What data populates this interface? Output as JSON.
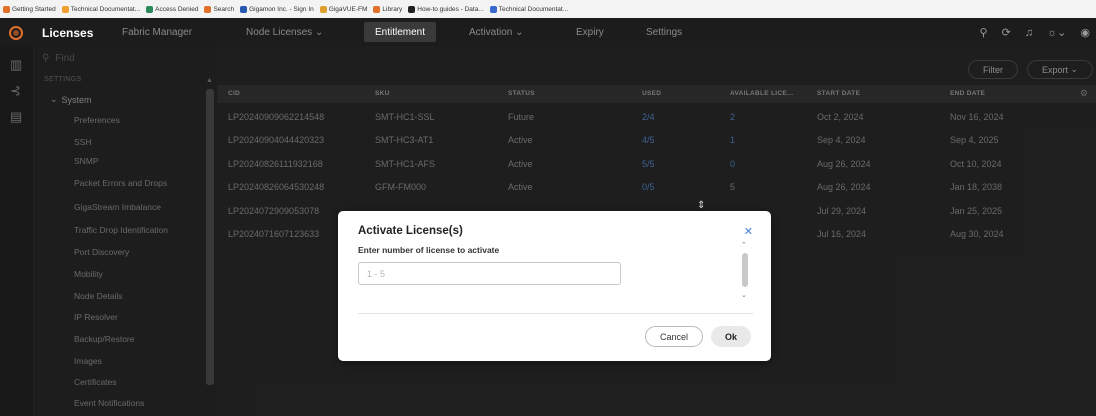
{
  "bookmarks": [
    {
      "label": "Getting Started",
      "color": "#e0702a"
    },
    {
      "label": "Technical Documentat...",
      "color": "#f0a030"
    },
    {
      "label": "Access Denied",
      "color": "#2a8a5a"
    },
    {
      "label": "Search",
      "color": "#e0702a"
    },
    {
      "label": "Gigamon Inc. - Sign In",
      "color": "#2a5ab0"
    },
    {
      "label": "GigaVUE-FM",
      "color": "#e0a030"
    },
    {
      "label": "Library",
      "color": "#e0702a"
    },
    {
      "label": "How-to guides - Data...",
      "color": "#222222"
    },
    {
      "label": "Technical Documentat...",
      "color": "#3a6ad0"
    }
  ],
  "topnav": {
    "product": "Licenses",
    "app": "Fabric Manager",
    "tabs": [
      "Node Licenses",
      "Entitlement",
      "Activation",
      "Expiry",
      "Settings"
    ],
    "active_tab": "Entitlement"
  },
  "sidebar": {
    "search_placeholder": "Find",
    "section": "SETTINGS",
    "group": "System",
    "items": [
      "Preferences",
      "SSH",
      "SNMP",
      "Packet Errors and Drops",
      "GigaStream Imbalance",
      "Traffic Drop Identification",
      "Port Discovery",
      "Mobility",
      "Node Details",
      "IP Resolver",
      "Backup/Restore",
      "Images",
      "Certificates",
      "Event Notifications"
    ]
  },
  "toolbar": {
    "filter": "Filter",
    "export": "Export"
  },
  "table": {
    "headers": [
      "CID",
      "SKU",
      "STATUS",
      "USED",
      "AVAILABLE LICE...",
      "START DATE",
      "END DATE"
    ],
    "rows": [
      [
        "LP20240909062214548",
        "SMT-HC1-SSL",
        "Future",
        "2/4",
        "2",
        "Oct 2, 2024",
        "Nov 16, 2024"
      ],
      [
        "LP20240904044420323",
        "SMT-HC3-AT1",
        "Active",
        "4/5",
        "1",
        "Sep 4, 2024",
        "Sep 4, 2025"
      ],
      [
        "LP20240826111932168",
        "SMT-HC1-AFS",
        "Active",
        "5/5",
        "0",
        "Aug 26, 2024",
        "Oct 10, 2024"
      ],
      [
        "LP20240826064530248",
        "GFM-FM000",
        "Active",
        "0/5",
        "5",
        "Aug 26, 2024",
        "Jan 18, 2038"
      ],
      [
        "LP2024072909053078",
        "",
        "",
        "",
        "",
        "Jul 29, 2024",
        "Jan 25, 2025"
      ],
      [
        "LP2024071607123633",
        "",
        "",
        "",
        "",
        "Jul 16, 2024",
        "Aug 30, 2024"
      ]
    ]
  },
  "modal": {
    "title": "Activate License(s)",
    "label": "Enter number of license to activate",
    "placeholder": "1 - 5",
    "cancel": "Cancel",
    "ok": "Ok"
  }
}
